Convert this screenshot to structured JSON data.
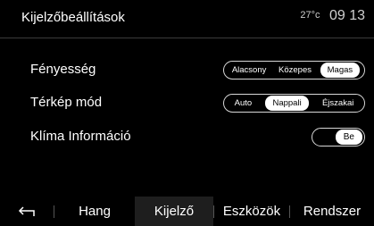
{
  "header": {
    "title": "Kijelzőbeállítások",
    "temperature": "27°c",
    "time": "09 13"
  },
  "settings": {
    "brightness": {
      "label": "Fényesség",
      "options": [
        "Alacsony",
        "Közepes",
        "Magas"
      ],
      "selected": "Magas"
    },
    "map_mode": {
      "label": "Térkép mód",
      "options": [
        "Auto",
        "Nappali",
        "Éjszakai"
      ],
      "selected": "Nappali"
    },
    "climate_info": {
      "label": "Klíma Információ",
      "value": "Be"
    }
  },
  "tabs": {
    "back_icon": "back-arrow-icon",
    "items": [
      "Hang",
      "Kijelző",
      "Eszközök",
      "Rendszer"
    ],
    "active": "Kijelző"
  }
}
